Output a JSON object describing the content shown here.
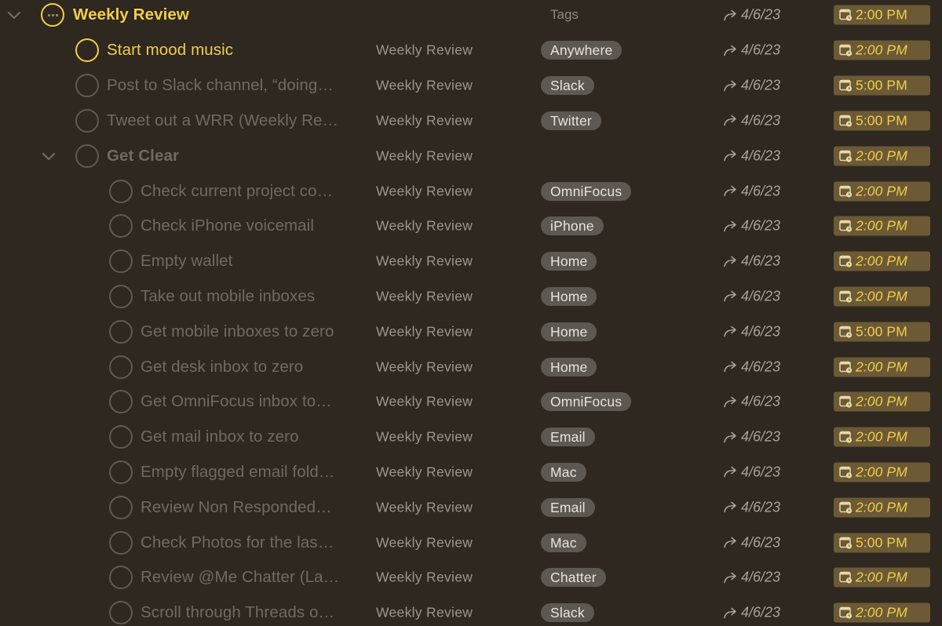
{
  "header_row": {
    "title": "Weekly Review",
    "tags_label": "Tags",
    "defer_date": "4/6/23",
    "due_time": "2:00 PM"
  },
  "rows": [
    {
      "title": "Start mood music",
      "project": "Weekly Review",
      "tag": "Anywhere",
      "defer_date": "4/6/23",
      "due_time": "2:00 PM",
      "state": "active",
      "indent": 1
    },
    {
      "title": "Post to Slack channel, “doing…",
      "project": "Weekly Review",
      "tag": "Slack",
      "defer_date": "4/6/23",
      "due_time": "5:00 PM",
      "state": "dimmed",
      "indent": 1
    },
    {
      "title": "Tweet out a WRR (Weekly Re…",
      "project": "Weekly Review",
      "tag": "Twitter",
      "defer_date": "4/6/23",
      "due_time": "5:00 PM",
      "state": "dimmed",
      "indent": 1
    },
    {
      "title": "Get Clear",
      "project": "Weekly Review",
      "tag": "",
      "defer_date": "4/6/23",
      "due_time": "2:00 PM",
      "state": "group",
      "indent": 1
    },
    {
      "title": "Check current project co…",
      "project": "Weekly Review",
      "tag": "OmniFocus",
      "defer_date": "4/6/23",
      "due_time": "2:00 PM",
      "state": "dimmed",
      "indent": 2
    },
    {
      "title": "Check iPhone voicemail",
      "project": "Weekly Review",
      "tag": "iPhone",
      "defer_date": "4/6/23",
      "due_time": "2:00 PM",
      "state": "dimmed",
      "indent": 2
    },
    {
      "title": "Empty wallet",
      "project": "Weekly Review",
      "tag": "Home",
      "defer_date": "4/6/23",
      "due_time": "2:00 PM",
      "state": "dimmed",
      "indent": 2
    },
    {
      "title": "Take out mobile inboxes",
      "project": "Weekly Review",
      "tag": "Home",
      "defer_date": "4/6/23",
      "due_time": "2:00 PM",
      "state": "dimmed",
      "indent": 2
    },
    {
      "title": "Get mobile inboxes to zero",
      "project": "Weekly Review",
      "tag": "Home",
      "defer_date": "4/6/23",
      "due_time": "5:00 PM",
      "state": "dimmed",
      "indent": 2
    },
    {
      "title": "Get desk inbox to zero",
      "project": "Weekly Review",
      "tag": "Home",
      "defer_date": "4/6/23",
      "due_time": "2:00 PM",
      "state": "dimmed",
      "indent": 2
    },
    {
      "title": "Get OmniFocus inbox to…",
      "project": "Weekly Review",
      "tag": "OmniFocus",
      "defer_date": "4/6/23",
      "due_time": "2:00 PM",
      "state": "dimmed",
      "indent": 2
    },
    {
      "title": "Get mail inbox to zero",
      "project": "Weekly Review",
      "tag": "Email",
      "defer_date": "4/6/23",
      "due_time": "2:00 PM",
      "state": "dimmed",
      "indent": 2
    },
    {
      "title": "Empty flagged email fold…",
      "project": "Weekly Review",
      "tag": "Mac",
      "defer_date": "4/6/23",
      "due_time": "2:00 PM",
      "state": "dimmed",
      "indent": 2
    },
    {
      "title": "Review Non Responded…",
      "project": "Weekly Review",
      "tag": "Email",
      "defer_date": "4/6/23",
      "due_time": "2:00 PM",
      "state": "dimmed",
      "indent": 2
    },
    {
      "title": "Check Photos for the las…",
      "project": "Weekly Review",
      "tag": "Mac",
      "defer_date": "4/6/23",
      "due_time": "5:00 PM",
      "state": "dimmed",
      "indent": 2
    },
    {
      "title": "Review @Me Chatter (La…",
      "project": "Weekly Review",
      "tag": "Chatter",
      "defer_date": "4/6/23",
      "due_time": "2:00 PM",
      "state": "dimmed",
      "indent": 2
    },
    {
      "title": "Scroll through Threads o…",
      "project": "Weekly Review",
      "tag": "Slack",
      "defer_date": "4/6/23",
      "due_time": "2:00 PM",
      "state": "dimmed",
      "indent": 2
    }
  ],
  "icons": {
    "collapse": "chevron-down-icon",
    "project_status": "more-dots-icon",
    "defer": "defer-arrow-icon",
    "due": "calendar-clock-icon"
  },
  "colors": {
    "background": "#2e2820",
    "accent": "#f2cd4a",
    "due_badge": "#6b5a35",
    "tag_pill": "#5d5851"
  }
}
